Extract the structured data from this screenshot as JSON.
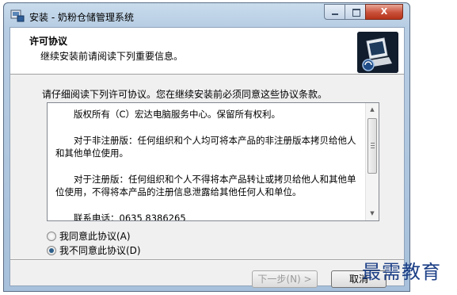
{
  "window": {
    "title": "安装 - 奶粉仓储管理系统",
    "controls": {
      "close_label": "X"
    }
  },
  "header": {
    "title": "许可协议",
    "subtitle": "继续安装前请阅读下列重要信息。",
    "image_icon": "computer-install-icon"
  },
  "intro": "请仔细阅读下列许可协议。您在继续安装前必须同意这些协议条款。",
  "license": {
    "paragraphs": [
      "版权所有（C）宏达电脑服务中心。保留所有权利。",
      "对于非注册版：任何组织和个人均可将本产品的非注册版本拷贝给他人和其他单位使用。",
      "对于注册版：任何组织和个人不得将本产品转让或拷贝给他人和其他单位使用，不得将本产品的注册信息泄露给其他任何人和单位。",
      "联系电话：0635 8386265"
    ]
  },
  "radios": {
    "accept_label": "我同意此协议(A)",
    "decline_label": "我不同意此协议(D)",
    "selected": "decline"
  },
  "buttons": {
    "next_label": "下一步(N) >",
    "cancel_label": "取消"
  },
  "watermark": "最需教育",
  "colors": {
    "header_bg": "#ffffff",
    "client_bg": "#f0f0f0",
    "close_button": "#c9503a",
    "watermark": "#1c3f86"
  }
}
